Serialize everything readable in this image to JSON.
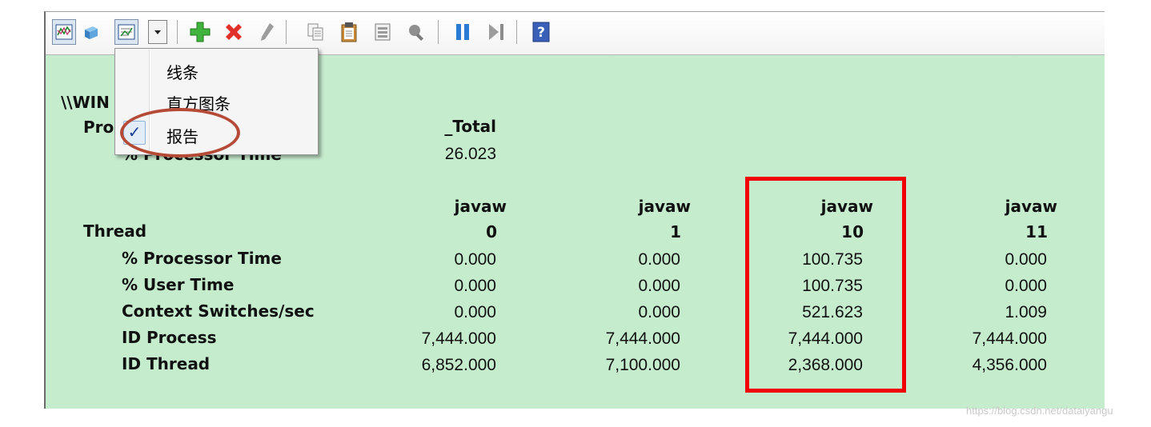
{
  "menu": {
    "items": [
      "线条",
      "直方图条",
      "报告"
    ],
    "checked_mark": "✓",
    "checked_index": 2
  },
  "report": {
    "machine_label": "\\\\WIN",
    "process_label": "Pro",
    "process_counter_label": "% Processor Time",
    "process_instance": "_Total",
    "process_value": "26.023",
    "thread_label": "Thread",
    "instances": [
      {
        "name": "javaw",
        "id": "0"
      },
      {
        "name": "javaw",
        "id": "1"
      },
      {
        "name": "javaw",
        "id": "10"
      },
      {
        "name": "javaw",
        "id": "11"
      }
    ],
    "counters": [
      {
        "label": "% Processor Time",
        "values": [
          "0.000",
          "0.000",
          "100.735",
          "0.000"
        ]
      },
      {
        "label": "% User Time",
        "values": [
          "0.000",
          "0.000",
          "100.735",
          "0.000"
        ]
      },
      {
        "label": "Context Switches/sec",
        "values": [
          "0.000",
          "0.000",
          "521.623",
          "1.009"
        ]
      },
      {
        "label": "ID Process",
        "values": [
          "7,444.000",
          "7,444.000",
          "7,444.000",
          "7,444.000"
        ]
      },
      {
        "label": "ID Thread",
        "values": [
          "6,852.000",
          "7,100.000",
          "2,368.000",
          "4,356.000"
        ]
      }
    ]
  },
  "toolbar": {
    "icons": [
      "line-chart-view-icon",
      "histogram-view-icon",
      "report-view-icon",
      "view-dropdown-icon",
      "add-counter-icon",
      "delete-counter-icon",
      "highlight-icon",
      "copy-properties-icon",
      "paste-counter-list-icon",
      "properties-icon",
      "zoom-icon",
      "freeze-display-icon",
      "update-data-icon",
      "help-icon"
    ]
  },
  "colors": {
    "report_background": "#c6ecce",
    "highlight_box": "#f00000",
    "annotation_oval": "#b54a36"
  },
  "watermark": "https://blog.csdn.net/dataiyangu"
}
